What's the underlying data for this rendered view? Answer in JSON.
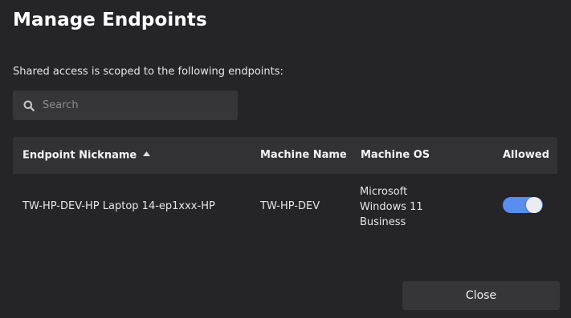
{
  "dialog": {
    "title": "Manage Endpoints",
    "subtitle": "Shared access is scoped to the following endpoints:"
  },
  "search": {
    "placeholder": "Search",
    "value": "",
    "icon": "search-icon"
  },
  "table": {
    "columns": [
      {
        "label": "Endpoint Nickname",
        "sort": "ascending"
      },
      {
        "label": "Machine Name"
      },
      {
        "label": "Machine OS"
      },
      {
        "label": "Allowed"
      }
    ],
    "rows": [
      {
        "nickname": "TW-HP-DEV-HP Laptop 14-ep1xxx-HP",
        "machine_name": "TW-HP-DEV",
        "machine_os": "Microsoft Windows 11 Business",
        "allowed": true
      }
    ]
  },
  "footer": {
    "close_label": "Close"
  },
  "colors": {
    "background": "#252528",
    "surface": "#36363a",
    "header": "#323236",
    "toggle_on": "#5b8df0"
  }
}
